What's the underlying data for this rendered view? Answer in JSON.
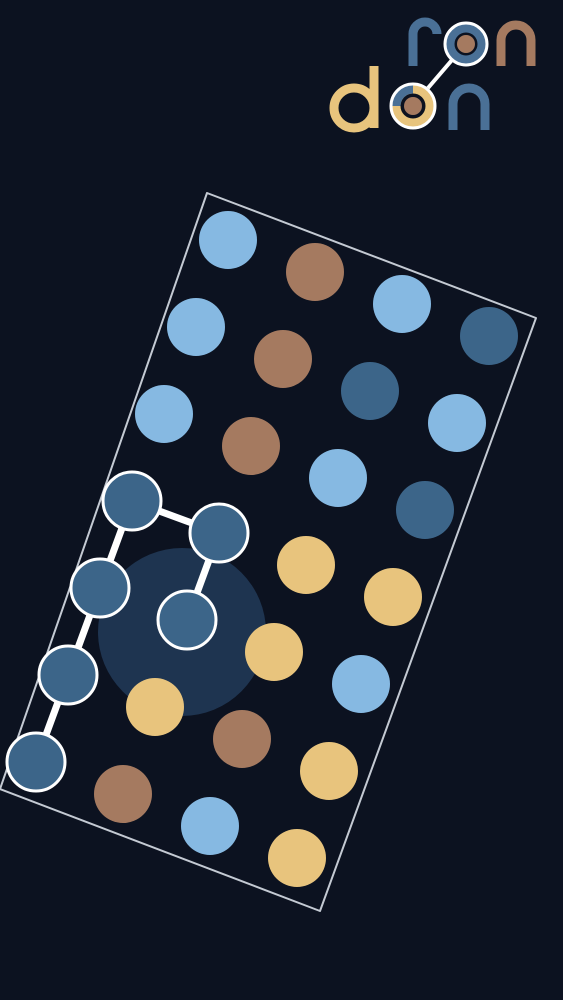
{
  "app": {
    "logo": "ron don"
  },
  "colors": {
    "background": "#0c1220",
    "board_border": "#c4cad3",
    "light_blue": "#86b9e2",
    "dark_blue": "#3c6589",
    "brown": "#a57a60",
    "yellow": "#e8c47d",
    "selection_line": "#ffffff",
    "drop_target": "#1e3450"
  },
  "board": {
    "rows": 7,
    "cols": 4,
    "cells": [
      [
        "light_blue",
        "brown",
        "light_blue",
        "dark_blue"
      ],
      [
        "light_blue",
        "brown",
        "dark_blue",
        "light_blue"
      ],
      [
        "light_blue",
        "brown",
        "light_blue",
        "dark_blue"
      ],
      [
        "dark_blue",
        "dark_blue",
        "yellow",
        "yellow"
      ],
      [
        "dark_blue",
        "dark_blue",
        "yellow",
        "light_blue"
      ],
      [
        "dark_blue",
        "yellow",
        "brown",
        "yellow"
      ],
      [
        "dark_blue",
        "brown",
        "light_blue",
        "yellow"
      ]
    ],
    "selected_path": [
      [
        6,
        0
      ],
      [
        5,
        0
      ],
      [
        4,
        0
      ],
      [
        3,
        0
      ],
      [
        3,
        1
      ],
      [
        4,
        1
      ]
    ]
  }
}
